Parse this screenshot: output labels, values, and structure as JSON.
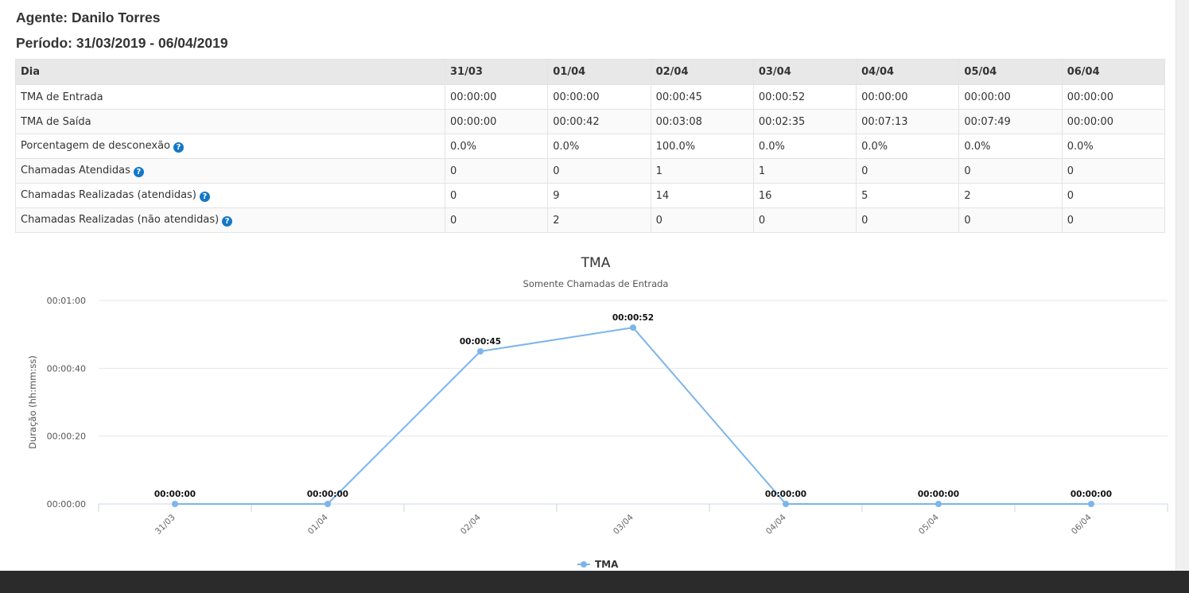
{
  "report": {
    "agent": "Agente: Danilo Torres",
    "period": "Período: 31/03/2019 - 06/04/2019"
  },
  "table": {
    "headers": [
      "Dia",
      "31/03",
      "01/04",
      "02/04",
      "03/04",
      "04/04",
      "05/04",
      "06/04"
    ],
    "rows": [
      {
        "label": "TMA de Entrada",
        "help": false,
        "cells": [
          "00:00:00",
          "00:00:00",
          "00:00:45",
          "00:00:52",
          "00:00:00",
          "00:00:00",
          "00:00:00"
        ]
      },
      {
        "label": "TMA de Saída",
        "help": false,
        "cells": [
          "00:00:00",
          "00:00:42",
          "00:03:08",
          "00:02:35",
          "00:07:13",
          "00:07:49",
          "00:00:00"
        ]
      },
      {
        "label": "Porcentagem de desconexão",
        "help": true,
        "cells": [
          "0.0%",
          "0.0%",
          "100.0%",
          "0.0%",
          "0.0%",
          "0.0%",
          "0.0%"
        ]
      },
      {
        "label": "Chamadas Atendidas",
        "help": true,
        "cells": [
          "0",
          "0",
          "1",
          "1",
          "0",
          "0",
          "0"
        ]
      },
      {
        "label": "Chamadas Realizadas (atendidas)",
        "help": true,
        "cells": [
          "0",
          "9",
          "14",
          "16",
          "5",
          "2",
          "0"
        ]
      },
      {
        "label": "Chamadas Realizadas (não atendidas)",
        "help": true,
        "cells": [
          "0",
          "2",
          "0",
          "0",
          "0",
          "0",
          "0"
        ]
      }
    ]
  },
  "help_icon": "question-circle-icon",
  "colors": {
    "series": "#7cb5ec",
    "help_icon": "#1478c8",
    "header_bg": "#e8e8e8"
  },
  "chart_data": {
    "type": "line",
    "title": "TMA",
    "subtitle": "Somente Chamadas de Entrada",
    "ylabel": "Duração (hh:mm:ss)",
    "xlabel": "",
    "categories": [
      "31/03",
      "01/04",
      "02/04",
      "03/04",
      "04/04",
      "05/04",
      "06/04"
    ],
    "series": [
      {
        "name": "TMA",
        "values_seconds": [
          0,
          0,
          45,
          52,
          0,
          0,
          0
        ],
        "labels": [
          "00:00:00",
          "00:00:00",
          "00:00:45",
          "00:00:52",
          "00:00:00",
          "00:00:00",
          "00:00:00"
        ]
      }
    ],
    "ylim_seconds": [
      0,
      60
    ],
    "y_ticks": [
      "00:00:00",
      "00:00:20",
      "00:00:40",
      "00:01:00"
    ],
    "y_tick_values": [
      0,
      20,
      40,
      60
    ],
    "grid": true,
    "legend": "bottom-center"
  }
}
